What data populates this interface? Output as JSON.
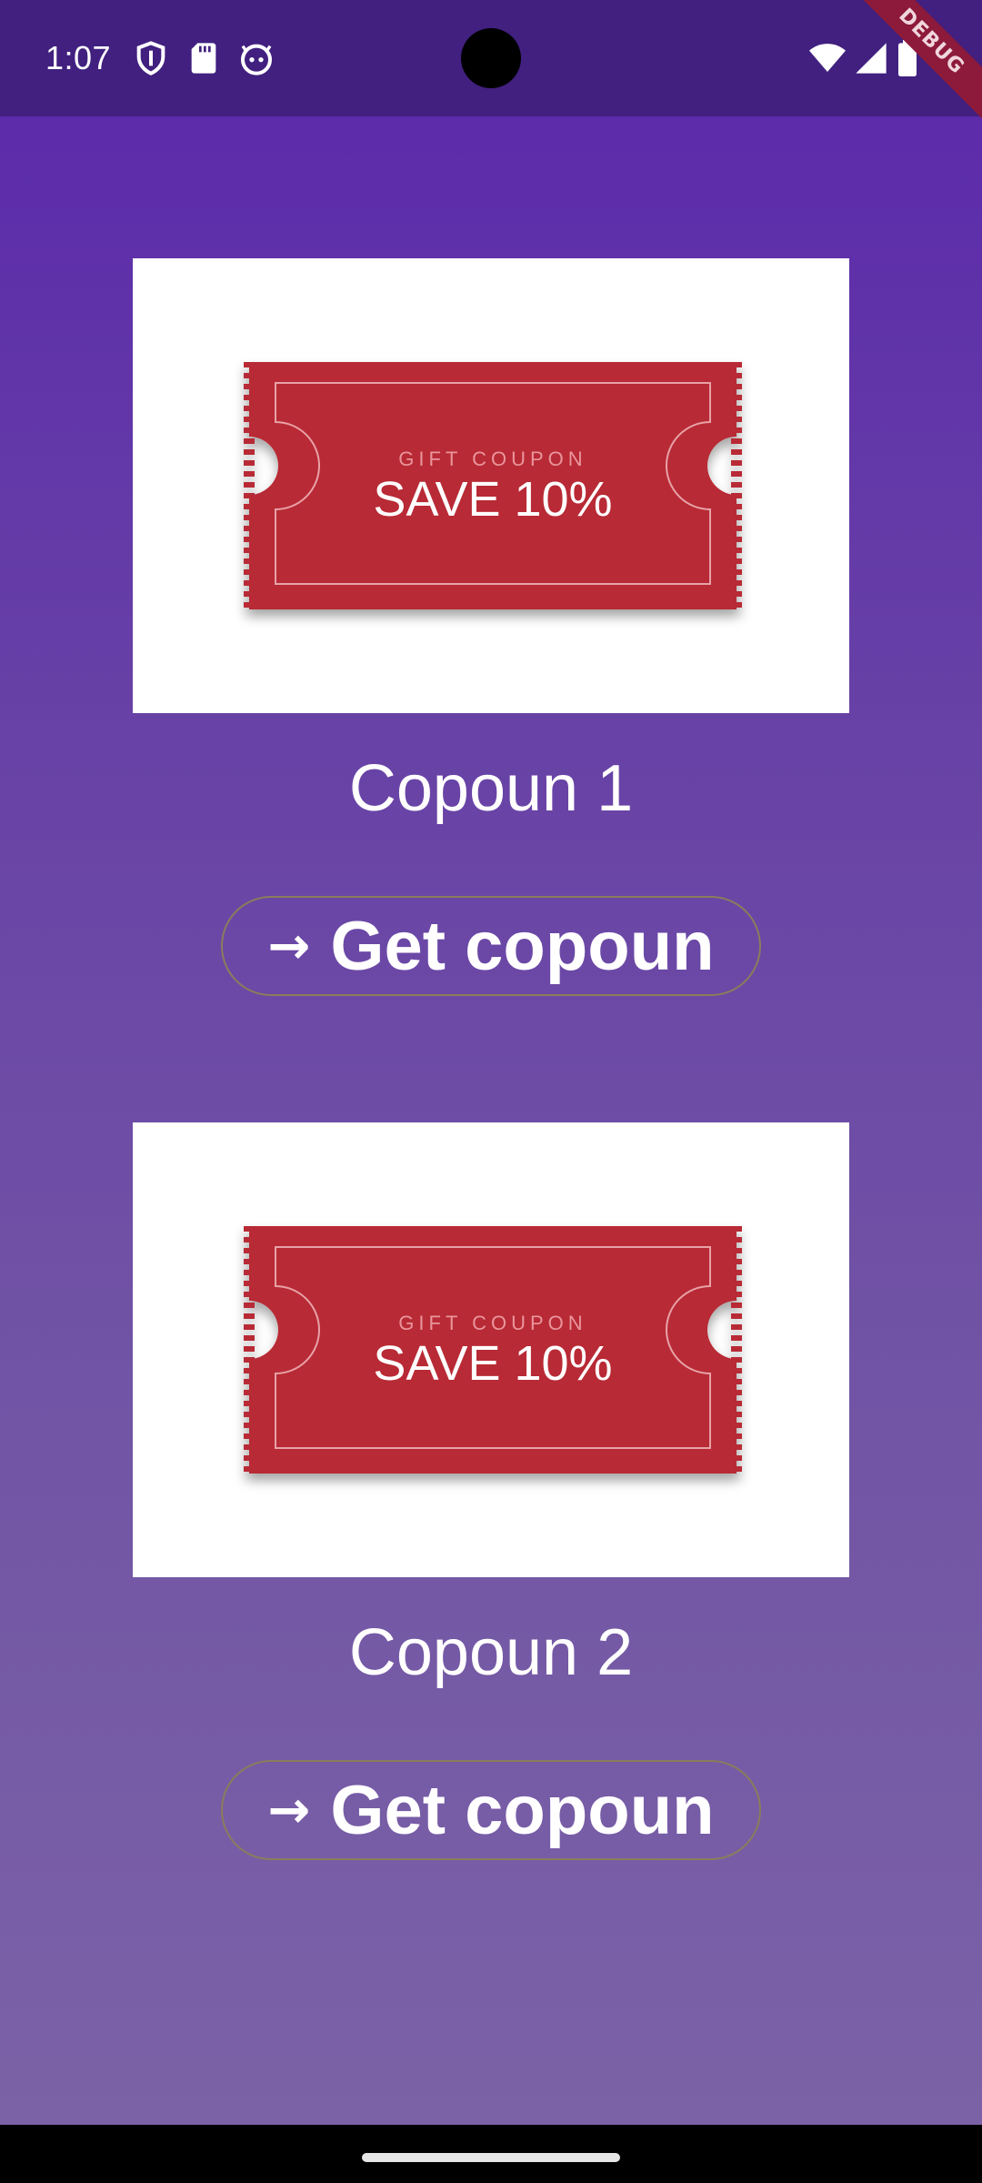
{
  "status_bar": {
    "time": "1:07",
    "icons": [
      "shield-icon",
      "sd-card-icon",
      "android-face-icon",
      "wifi-icon",
      "signal-icon",
      "battery-icon"
    ],
    "debug_label": "DEBUG"
  },
  "coupons": [
    {
      "title": "Copoun 1",
      "ticket_small_text": "GIFT COUPON",
      "ticket_big_text": "SAVE 10%",
      "button_label": "Get copoun",
      "button_icon": "arrow-right-icon"
    },
    {
      "title": "Copoun 2",
      "ticket_small_text": "GIFT COUPON",
      "ticket_big_text": "SAVE 10%",
      "button_label": "Get copoun",
      "button_icon": "arrow-right-icon"
    }
  ],
  "colors": {
    "background_top": "#5a27ab",
    "background_bottom": "#7b62a6",
    "status_bar": "#41207f",
    "ticket_red": "#b82b34",
    "button_border": "#8a7d5c",
    "debug_ribbon": "#8d1a3b"
  }
}
